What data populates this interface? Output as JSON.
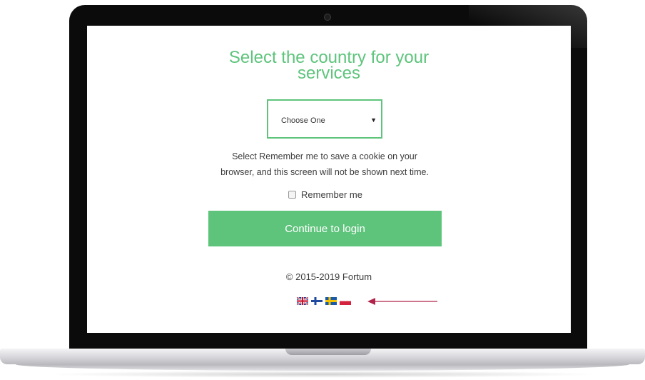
{
  "page": {
    "title_line1": "Select the country for your",
    "title_line2": "services"
  },
  "country_select": {
    "value": "Choose One"
  },
  "info_text": {
    "line1": "Select Remember me to save a cookie on your",
    "line2": "browser, and this screen will not be shown next time."
  },
  "remember_me": {
    "label": "Remember me",
    "checked": false
  },
  "continue_button": {
    "label": "Continue to login"
  },
  "footer": {
    "copyright": "© 2015-2019 Fortum"
  },
  "languages": [
    {
      "icon": "uk-flag-icon"
    },
    {
      "icon": "finland-flag-icon"
    },
    {
      "icon": "sweden-flag-icon"
    },
    {
      "icon": "poland-flag-icon"
    }
  ],
  "colors": {
    "accent": "#5ec47c",
    "arrow": "#b0234a",
    "bezel": "#0b0b0b"
  }
}
